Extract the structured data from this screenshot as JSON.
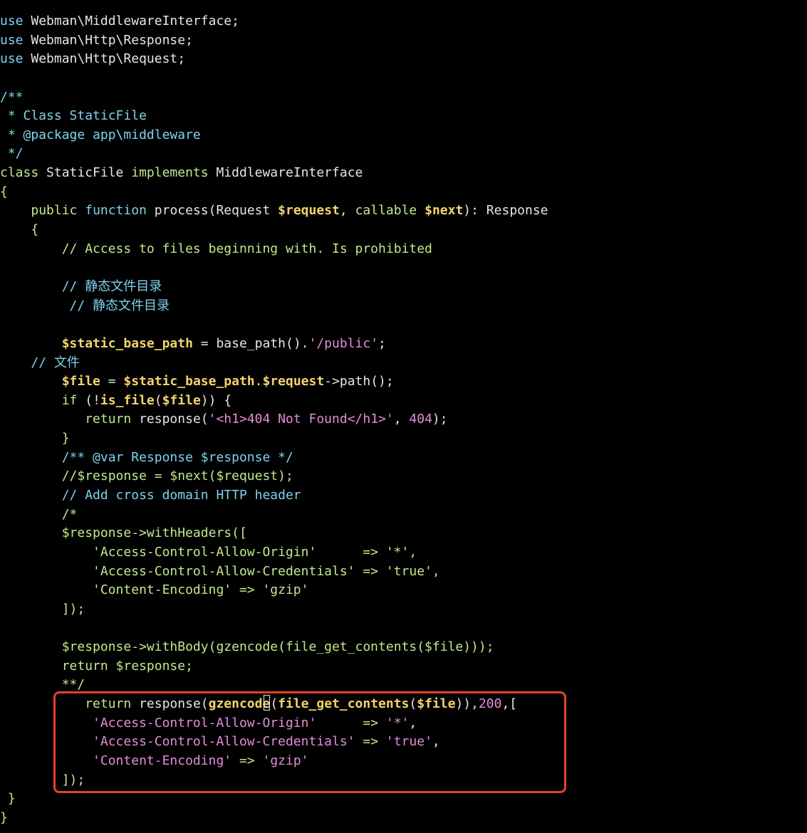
{
  "theme": {
    "background": "#000000",
    "text": "#e6e6e6",
    "keyword": "#7fd3ee",
    "string": "#c3e88d",
    "variable": "#f2d46b",
    "number": "#e58cd8",
    "highlight_border": "#e3412b"
  },
  "lines": [
    [
      {
        "c": "kw",
        "t": "use"
      },
      {
        "c": "fn",
        "t": " Webman\\MiddlewareInterface;"
      }
    ],
    [
      {
        "c": "kw",
        "t": "use"
      },
      {
        "c": "fn",
        "t": " Webman\\Http\\Response;"
      }
    ],
    [
      {
        "c": "kw",
        "t": "use"
      },
      {
        "c": "fn",
        "t": " Webman\\Http\\Request;"
      }
    ],
    [],
    [
      {
        "c": "cmt2",
        "t": "/**"
      }
    ],
    [
      {
        "c": "cmt2",
        "t": " * Class StaticFile"
      }
    ],
    [
      {
        "c": "cmt2",
        "t": " * @package app\\middleware"
      }
    ],
    [
      {
        "c": "cmt2",
        "t": " */"
      }
    ],
    [
      {
        "c": "kw2",
        "t": "class"
      },
      {
        "c": "fn",
        "t": " StaticFile "
      },
      {
        "c": "kw2",
        "t": "implements"
      },
      {
        "c": "fn",
        "t": " MiddlewareInterface"
      }
    ],
    [
      {
        "c": "str",
        "t": "{"
      }
    ],
    [
      {
        "c": "fn",
        "t": "    "
      },
      {
        "c": "kw2",
        "t": "public"
      },
      {
        "c": "fn",
        "t": " "
      },
      {
        "c": "kw",
        "t": "function"
      },
      {
        "c": "fn",
        "t": " process(Request "
      },
      {
        "c": "var",
        "t": "$request"
      },
      {
        "c": "fn",
        "t": ", "
      },
      {
        "c": "kw2",
        "t": "callable"
      },
      {
        "c": "fn",
        "t": " "
      },
      {
        "c": "var",
        "t": "$next"
      },
      {
        "c": "fn",
        "t": "): Response"
      }
    ],
    [
      {
        "c": "fn",
        "t": "    "
      },
      {
        "c": "str",
        "t": "{"
      }
    ],
    [
      {
        "c": "fn",
        "t": "        "
      },
      {
        "c": "cmt",
        "t": "// Access to files beginning with. Is prohibited"
      }
    ],
    [],
    [
      {
        "c": "fn",
        "t": "        "
      },
      {
        "c": "kw",
        "t": "// 静态文件目录"
      }
    ],
    [
      {
        "c": "fn",
        "t": "         "
      },
      {
        "c": "kw",
        "t": "// 静态文件目录"
      }
    ],
    [],
    [
      {
        "c": "fn",
        "t": "        "
      },
      {
        "c": "var",
        "t": "$static_base_path"
      },
      {
        "c": "fn",
        "t": " = base_path()."
      },
      {
        "c": "str2",
        "t": "'/public'"
      },
      {
        "c": "fn",
        "t": ";"
      }
    ],
    [
      {
        "c": "fn",
        "t": "    "
      },
      {
        "c": "kw",
        "t": "// 文件"
      }
    ],
    [
      {
        "c": "fn",
        "t": "        "
      },
      {
        "c": "var",
        "t": "$file"
      },
      {
        "c": "fn",
        "t": " = "
      },
      {
        "c": "var",
        "t": "$static_base_path"
      },
      {
        "c": "fn",
        "t": "."
      },
      {
        "c": "var",
        "t": "$request"
      },
      {
        "c": "fn",
        "t": "->path();"
      }
    ],
    [
      {
        "c": "fn",
        "t": "        "
      },
      {
        "c": "kw2",
        "t": "if"
      },
      {
        "c": "fn",
        "t": " (!"
      },
      {
        "c": "fnb",
        "t": "is_file"
      },
      {
        "c": "fn",
        "t": "("
      },
      {
        "c": "var",
        "t": "$file"
      },
      {
        "c": "fn",
        "t": ")) {"
      }
    ],
    [
      {
        "c": "fn",
        "t": "           "
      },
      {
        "c": "kw2",
        "t": "return"
      },
      {
        "c": "fn",
        "t": " response("
      },
      {
        "c": "str2",
        "t": "'<h1>404 Not Found</h1>'"
      },
      {
        "c": "fn",
        "t": ", "
      },
      {
        "c": "num",
        "t": "404"
      },
      {
        "c": "fn",
        "t": ");"
      }
    ],
    [
      {
        "c": "fn",
        "t": "        "
      },
      {
        "c": "str",
        "t": "}"
      }
    ],
    [
      {
        "c": "fn",
        "t": "        "
      },
      {
        "c": "kw",
        "t": "/** @var Response $response */"
      }
    ],
    [
      {
        "c": "fn",
        "t": "        "
      },
      {
        "c": "str",
        "t": "//$response = $next($request);"
      }
    ],
    [
      {
        "c": "fn",
        "t": "        "
      },
      {
        "c": "kw",
        "t": "// Add cross domain HTTP header"
      }
    ],
    [
      {
        "c": "fn",
        "t": "        "
      },
      {
        "c": "str",
        "t": "/*"
      }
    ],
    [
      {
        "c": "fn",
        "t": "        "
      },
      {
        "c": "str",
        "t": "$response->withHeaders(["
      }
    ],
    [
      {
        "c": "fn",
        "t": "            "
      },
      {
        "c": "str",
        "t": "'Access-Control-Allow-Origin'      => '*',"
      }
    ],
    [
      {
        "c": "fn",
        "t": "            "
      },
      {
        "c": "str",
        "t": "'Access-Control-Allow-Credentials' => 'true',"
      }
    ],
    [
      {
        "c": "fn",
        "t": "            "
      },
      {
        "c": "str",
        "t": "'Content-Encoding' => 'gzip'"
      }
    ],
    [
      {
        "c": "fn",
        "t": "        "
      },
      {
        "c": "str",
        "t": "]);"
      }
    ],
    [],
    [
      {
        "c": "fn",
        "t": "        "
      },
      {
        "c": "str",
        "t": "$response->withBody(gzencode(file_get_contents($file)));"
      }
    ],
    [
      {
        "c": "fn",
        "t": "        "
      },
      {
        "c": "str",
        "t": "return $response;"
      }
    ],
    [
      {
        "c": "fn",
        "t": "        "
      },
      {
        "c": "str",
        "t": "**/"
      }
    ],
    [
      {
        "c": "fn",
        "t": "           "
      },
      {
        "c": "kw2",
        "t": "return"
      },
      {
        "c": "fn",
        "t": " response("
      },
      {
        "c": "fnb",
        "t": "gzencode"
      },
      {
        "c": "caret",
        "t": ""
      },
      {
        "c": "fn",
        "t": "("
      },
      {
        "c": "fnb",
        "t": "file_get_contents"
      },
      {
        "c": "fn",
        "t": "("
      },
      {
        "c": "var",
        "t": "$file"
      },
      {
        "c": "fn",
        "t": ")),"
      },
      {
        "c": "num",
        "t": "200"
      },
      {
        "c": "fn",
        "t": ",["
      }
    ],
    [
      {
        "c": "fn",
        "t": "            "
      },
      {
        "c": "str2",
        "t": "'Access-Control-Allow-Origin'"
      },
      {
        "c": "fn",
        "t": "      "
      },
      {
        "c": "str",
        "t": "=>"
      },
      {
        "c": "fn",
        "t": " "
      },
      {
        "c": "str2",
        "t": "'*'"
      },
      {
        "c": "fn",
        "t": ","
      }
    ],
    [
      {
        "c": "fn",
        "t": "            "
      },
      {
        "c": "str2",
        "t": "'Access-Control-Allow-Credentials'"
      },
      {
        "c": "fn",
        "t": " "
      },
      {
        "c": "str",
        "t": "=>"
      },
      {
        "c": "fn",
        "t": " "
      },
      {
        "c": "str2",
        "t": "'true'"
      },
      {
        "c": "fn",
        "t": ","
      }
    ],
    [
      {
        "c": "fn",
        "t": "            "
      },
      {
        "c": "str2",
        "t": "'Content-Encoding'"
      },
      {
        "c": "fn",
        "t": " "
      },
      {
        "c": "str",
        "t": "=>"
      },
      {
        "c": "fn",
        "t": " "
      },
      {
        "c": "str2",
        "t": "'gzip'"
      }
    ],
    [
      {
        "c": "fn",
        "t": "        "
      },
      {
        "c": "str",
        "t": "]);"
      }
    ],
    [
      {
        "c": "fn",
        "t": " "
      },
      {
        "c": "str",
        "t": "}"
      }
    ],
    [
      {
        "c": "str",
        "t": "}"
      }
    ]
  ]
}
